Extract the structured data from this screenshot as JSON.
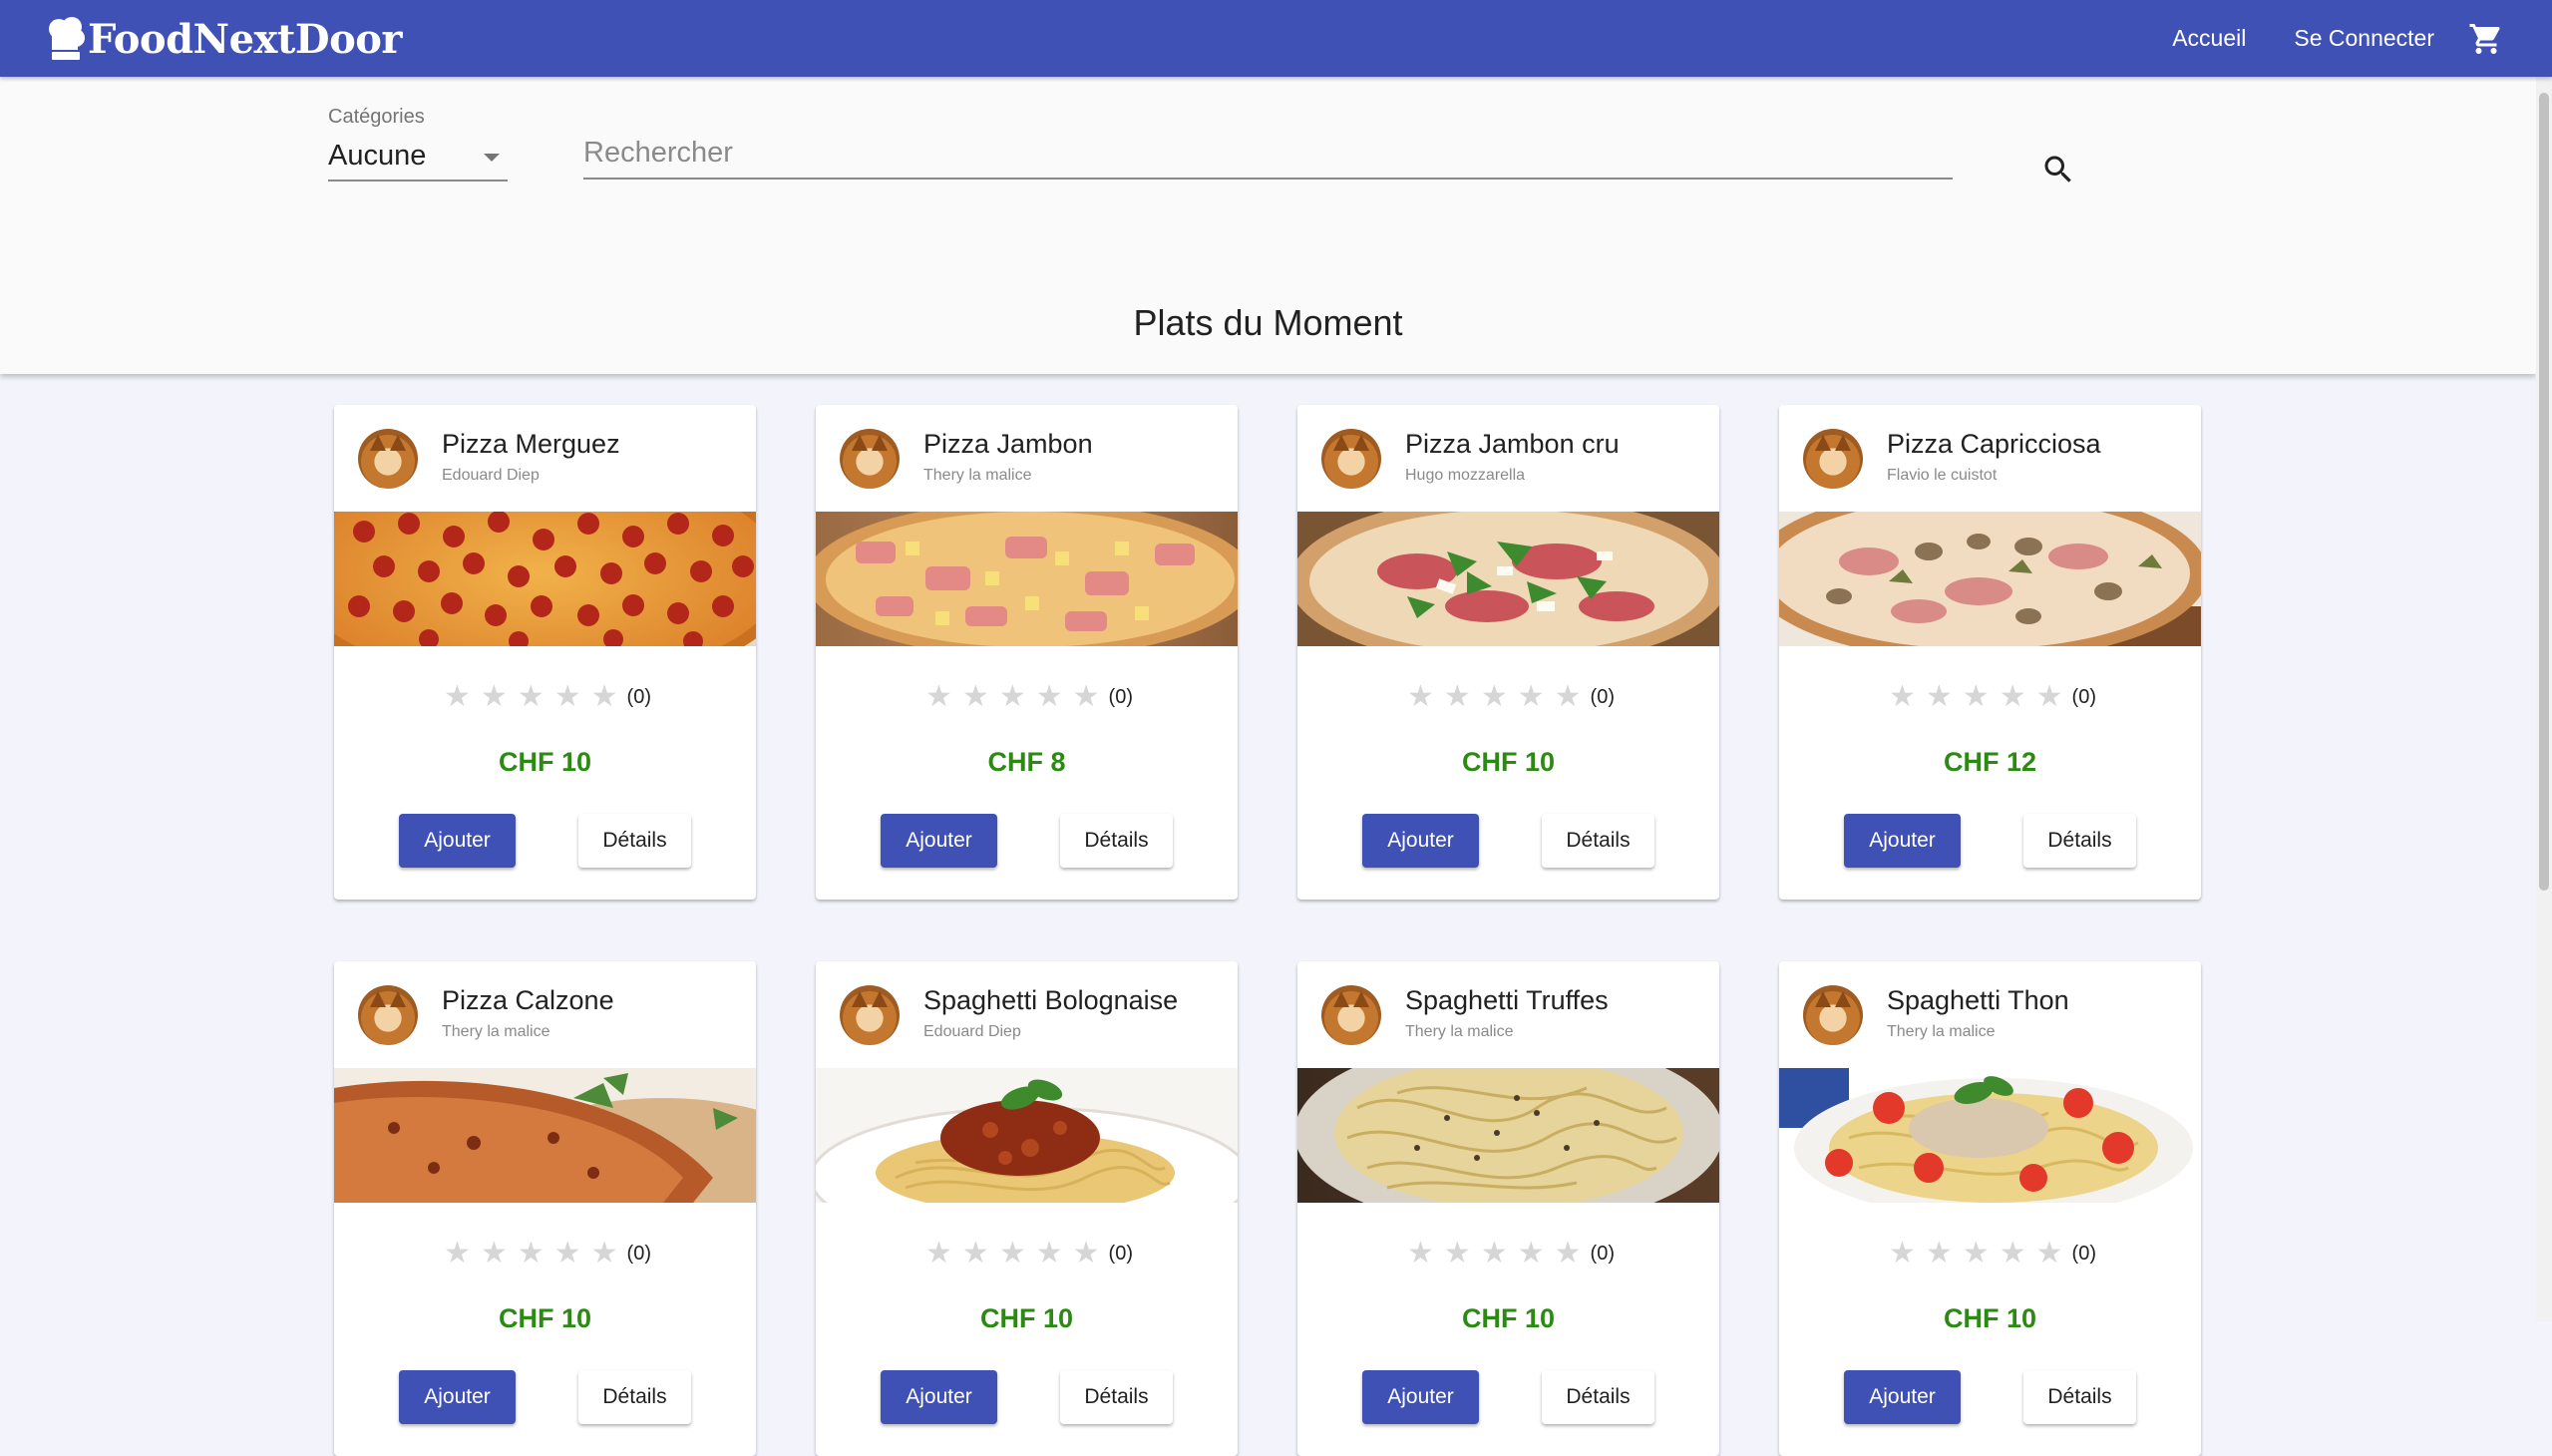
{
  "app": {
    "brand": "FoodNextDoor"
  },
  "nav": {
    "home": "Accueil",
    "login": "Se Connecter",
    "cart_icon": "shopping-cart-icon"
  },
  "filters": {
    "category_label": "Catégories",
    "category_value": "Aucune",
    "search_placeholder": "Rechercher",
    "search_icon": "search-icon"
  },
  "section_title": "Plats du Moment",
  "buttons": {
    "add": "Ajouter",
    "details": "Détails"
  },
  "dishes": [
    {
      "name": "Pizza Merguez",
      "chef": "Edouard Diep",
      "rating_count": "(0)",
      "price": "CHF 10",
      "image": "pepperoni"
    },
    {
      "name": "Pizza Jambon",
      "chef": "Thery la malice",
      "rating_count": "(0)",
      "price": "CHF 8",
      "image": "hawaiian"
    },
    {
      "name": "Pizza Jambon cru",
      "chef": "Hugo mozzarella",
      "rating_count": "(0)",
      "price": "CHF 10",
      "image": "prosciutto"
    },
    {
      "name": "Pizza Capricciosa",
      "chef": "Flavio le cuistot",
      "rating_count": "(0)",
      "price": "CHF 12",
      "image": "capricciosa"
    },
    {
      "name": "Pizza Calzone",
      "chef": "Thery la malice",
      "rating_count": "(0)",
      "price": "CHF 10",
      "image": "calzone"
    },
    {
      "name": "Spaghetti Bolognaise",
      "chef": "Edouard Diep",
      "rating_count": "(0)",
      "price": "CHF 10",
      "image": "bolognese"
    },
    {
      "name": "Spaghetti Truffes",
      "chef": "Thery la malice",
      "rating_count": "(0)",
      "price": "CHF 10",
      "image": "truffle"
    },
    {
      "name": "Spaghetti Thon",
      "chef": "Thery la malice",
      "rating_count": "(0)",
      "price": "CHF 10",
      "image": "tuna"
    }
  ],
  "colors": {
    "primary": "#3f51b5",
    "price": "#2a8a12",
    "star_empty": "#d6d6d6"
  }
}
